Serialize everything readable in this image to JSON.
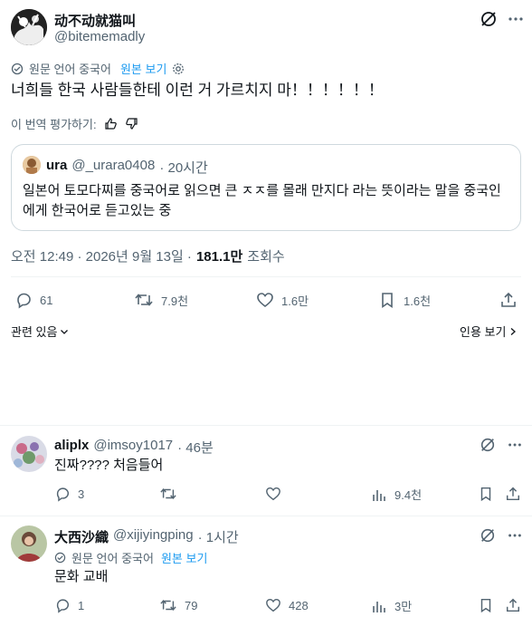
{
  "main_tweet": {
    "display_name": "动不动就猫叫",
    "handle": "@bitememadly",
    "translate_notice": "원문 언어 중국어",
    "view_original": "원본 보기",
    "text": "너희들 한국 사람들한테 이런 거 가르치지 마！！！！！！",
    "rate_translation": "이 번역 평가하기:",
    "quote": {
      "display_name": "ura",
      "handle": "@_urara0408",
      "time": "· 20시간",
      "text": "일본어 토모다찌를 중국어로 읽으면 큰 ㅈㅈ를 몰래 만지다 라는 뜻이라는 말을 중국인에게 한국어로 듣고있는 중"
    },
    "timestamp": "오전 12:49 · 2026년 9월 13일 ·",
    "views_count": "181.1만",
    "views_label": "조회수",
    "actions": {
      "replies": "61",
      "retweets": "7.9천",
      "likes": "1.6만",
      "bookmarks": "1.6천"
    },
    "relevance_label": "관련 있음",
    "quotes_link": "인용 보기"
  },
  "replies": [
    {
      "display_name": "aliplx",
      "handle": "@imsoy1017",
      "time": "· 46분",
      "text": "진짜???? 처음들어",
      "replies": "3",
      "retweets": "",
      "likes": "",
      "views": "9.4천"
    },
    {
      "display_name": "大西沙織",
      "handle": "@xijiyingping",
      "time": "· 1시간",
      "translate_notice": "원문 언어 중국어",
      "view_original": "원본 보기",
      "text": "문화 교배",
      "replies": "1",
      "retweets": "79",
      "likes": "428",
      "views": "3만"
    }
  ],
  "colors": {
    "text": "#0f1419",
    "muted": "#536471",
    "accent": "#1d9bf0",
    "border": "#cfd9de",
    "divider": "#eff3f4"
  }
}
